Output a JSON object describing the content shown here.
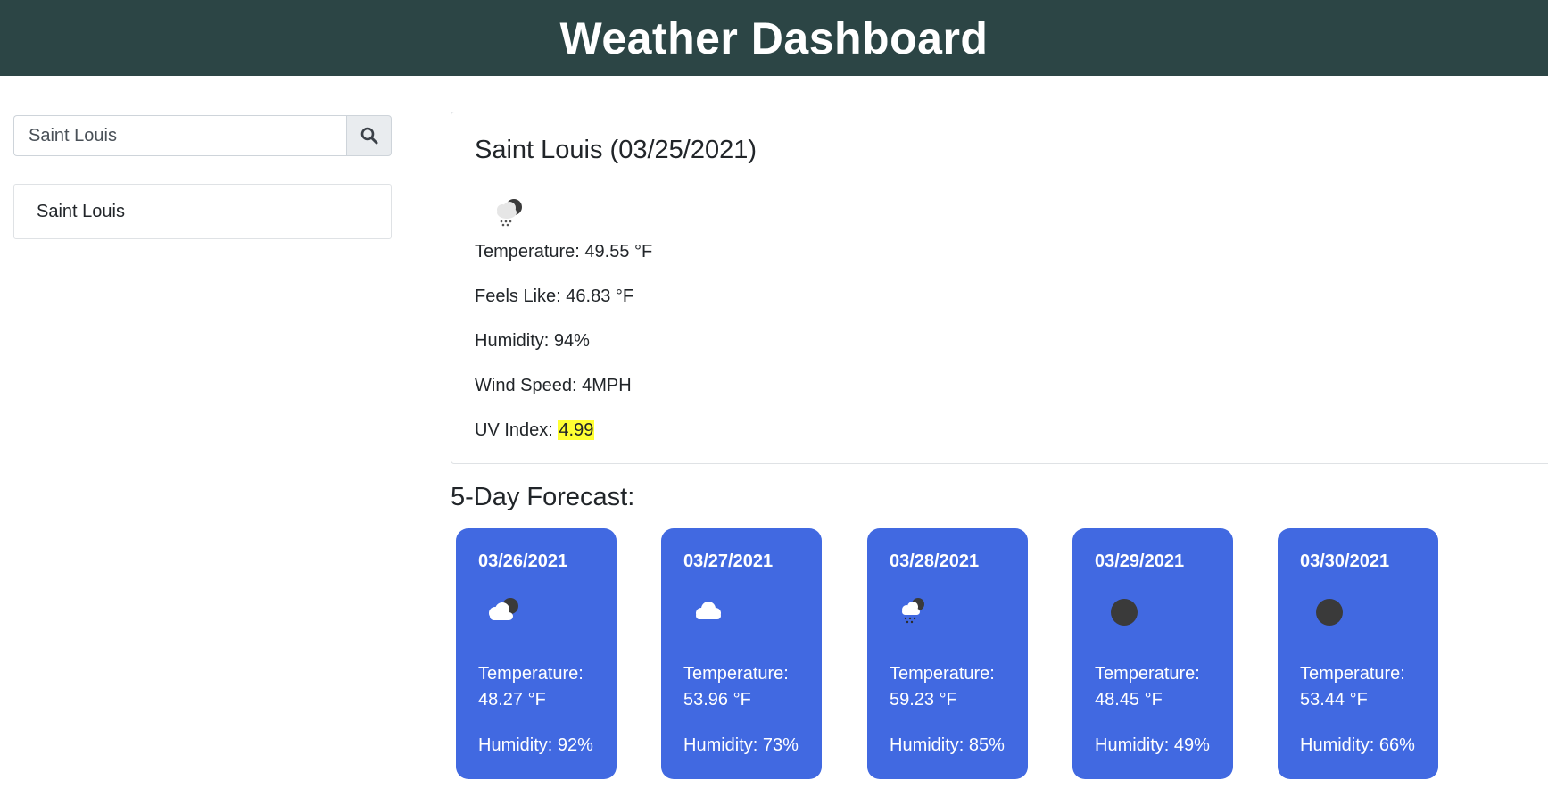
{
  "header": {
    "title": "Weather Dashboard"
  },
  "search": {
    "value": "Saint Louis",
    "button_icon": "search-icon"
  },
  "history": [
    "Saint Louis"
  ],
  "current": {
    "title": "Saint Louis (03/25/2021)",
    "icon": "rain-cloud-icon",
    "temperature": "Temperature: 49.55 °F",
    "feels_like": "Feels Like: 46.83 °F",
    "humidity": "Humidity: 94%",
    "wind": "Wind Speed: 4MPH",
    "uv_label": "UV Index:",
    "uv_value": "4.99",
    "uv_color": "#ffff33"
  },
  "forecast": {
    "heading": "5-Day Forecast:",
    "card_color": "#4169e1",
    "days": [
      {
        "date": "03/26/2021",
        "icon": "partly-cloudy-icon",
        "temp_label": "Temperature:",
        "temp": "48.27 °F",
        "humidity": "Humidity: 92%"
      },
      {
        "date": "03/27/2021",
        "icon": "cloud-icon",
        "temp_label": "Temperature:",
        "temp": "53.96 °F",
        "humidity": "Humidity: 73%"
      },
      {
        "date": "03/28/2021",
        "icon": "rain-cloud-icon",
        "temp_label": "Temperature:",
        "temp": "59.23 °F",
        "humidity": "Humidity: 85%"
      },
      {
        "date": "03/29/2021",
        "icon": "moon-icon",
        "temp_label": "Temperature:",
        "temp": "48.45 °F",
        "humidity": "Humidity: 49%"
      },
      {
        "date": "03/30/2021",
        "icon": "moon-icon",
        "temp_label": "Temperature:",
        "temp": "53.44 °F",
        "humidity": "Humidity: 66%"
      }
    ]
  }
}
